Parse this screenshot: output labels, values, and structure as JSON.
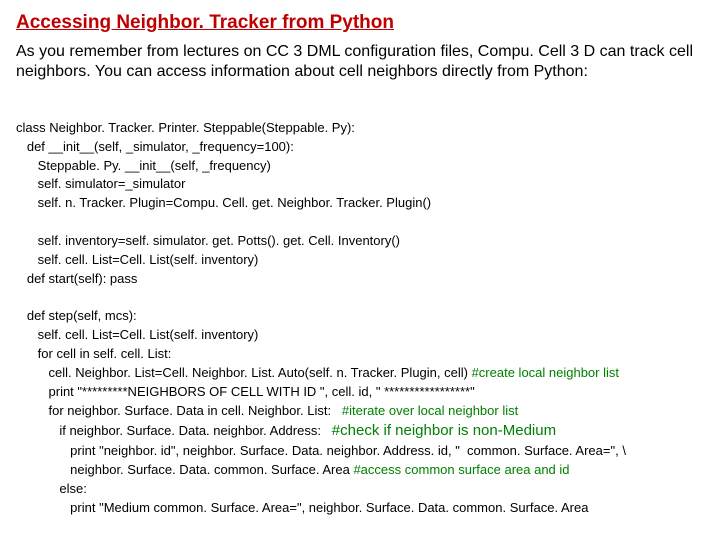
{
  "title": "Accessing Neighbor. Tracker from Python",
  "intro": "As you remember from lectures on CC 3 DML configuration files, Compu. Cell 3 D can track cell neighbors. You can access information about cell neighbors directly from Python:",
  "code": {
    "l1": "class Neighbor. Tracker. Printer. Steppable(Steppable. Py):",
    "l2": "   def __init__(self, _simulator, _frequency=100):",
    "l3": "      Steppable. Py. __init__(self, _frequency)",
    "l4": "      self. simulator=_simulator",
    "l5": "      self. n. Tracker. Plugin=Compu. Cell. get. Neighbor. Tracker. Plugin()",
    "l6": "      self. inventory=self. simulator. get. Potts(). get. Cell. Inventory()",
    "l7": "      self. cell. List=Cell. List(self. inventory)",
    "l8": "   def start(self): pass",
    "l9": "   def step(self, mcs):",
    "l10": "      self. cell. List=Cell. List(self. inventory)",
    "l11": "      for cell in self. cell. List:",
    "l12": "         cell. Neighbor. List=Cell. Neighbor. List. Auto(self. n. Tracker. Plugin, cell) ",
    "c12": "#create local neighbor list",
    "l13": "         print \"*********NEIGHBORS OF CELL WITH ID \", cell. id, \" *****************\"",
    "l14": "         for neighbor. Surface. Data in cell. Neighbor. List:   ",
    "c14": "#iterate over local neighbor list",
    "l15": "            if neighbor. Surface. Data. neighbor. Address:   ",
    "c15": "#check if neighbor is non-Medium",
    "l16": "               print \"neighbor. id\", neighbor. Surface. Data. neighbor. Address. id, \"  common. Surface. Area=\", \\",
    "l17": "               neighbor. Surface. Data. common. Surface. Area ",
    "c17": "#access common surface area and id",
    "l18": "            else:",
    "l19": "               print \"Medium common. Surface. Area=\", neighbor. Surface. Data. common. Surface. Area"
  }
}
